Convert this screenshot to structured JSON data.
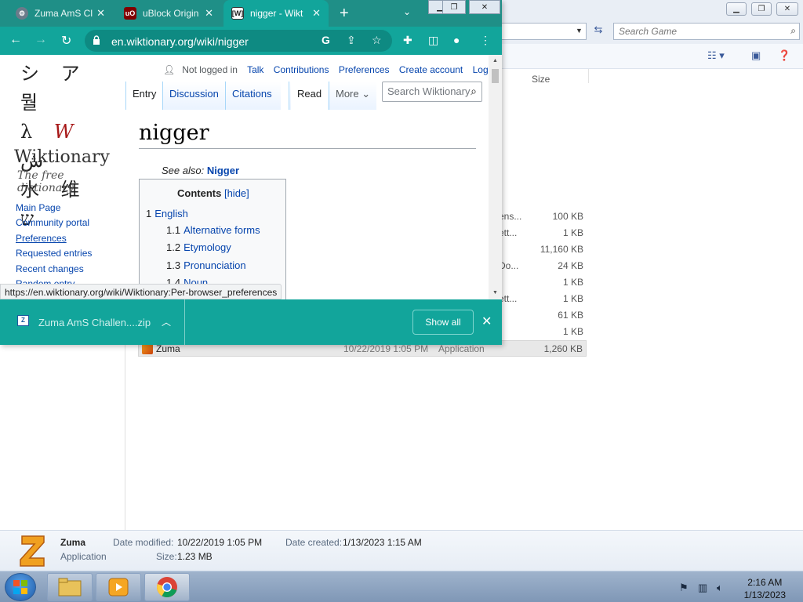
{
  "explorer": {
    "search_placeholder": "Search Game",
    "size_header": "Size",
    "rows": [
      {
        "name": "ens...",
        "size": "100 KB"
      },
      {
        "name": "ett...",
        "size": "1 KB"
      },
      {
        "name": "",
        "size": "11,160 KB"
      },
      {
        "name": "Do...",
        "size": "24 KB"
      },
      {
        "name": "",
        "size": "1 KB"
      },
      {
        "name": "ett...",
        "size": "1 KB"
      },
      {
        "name": "",
        "size": "61 KB"
      },
      {
        "name": "",
        "size": "1 KB"
      }
    ],
    "selected_row": {
      "name": "Zuma",
      "date": "10/22/2019 1:05 PM",
      "type": "Application",
      "size": "1,260 KB"
    },
    "details": {
      "name": "Zuma",
      "type": "Application",
      "date_modified_label": "Date modified:",
      "date_modified": "10/22/2019 1:05 PM",
      "date_created_label": "Date created:",
      "date_created": "1/13/2023 1:15 AM",
      "size_label": "Size:",
      "size": "1.23 MB"
    }
  },
  "taskbar": {
    "time": "2:16 AM",
    "date": "1/13/2023"
  },
  "chrome": {
    "tabs": [
      {
        "title": "Zuma AmS Cl",
        "icon": "zuma-tab-icon"
      },
      {
        "title": "uBlock Origin",
        "icon": "ublock-icon"
      },
      {
        "title": "nigger - Wikt",
        "icon": "wiktionary-icon",
        "active": true
      }
    ],
    "url": "en.wiktionary.org/wiki/nigger",
    "status_url": "https://en.wiktionary.org/wiki/Wiktionary:Per-browser_preferences",
    "download": {
      "filename": "Zuma AmS Challen....zip",
      "show_all": "Show all"
    }
  },
  "wiki": {
    "logo_name": "Wiktionary",
    "logo_tagline": "The free dictionary",
    "sidebar": [
      "Main Page",
      "Community portal",
      "Preferences",
      "Requested entries",
      "Recent changes",
      "Random entry"
    ],
    "personal": {
      "not_logged": "Not logged in",
      "talk": "Talk",
      "contributions": "Contributions",
      "preferences": "Preferences",
      "create": "Create account",
      "login": "Log in"
    },
    "tabs": {
      "entry": "Entry",
      "discussion": "Discussion",
      "citations": "Citations",
      "read": "Read",
      "more": "More"
    },
    "search_placeholder": "Search Wiktionary",
    "title": "nigger",
    "see_also_label": "See also:",
    "see_also_link": "Nigger",
    "toc": {
      "title": "Contents",
      "hide": "[hide]",
      "items": [
        {
          "num": "1",
          "label": "English"
        },
        {
          "num": "1.1",
          "label": "Alternative forms"
        },
        {
          "num": "1.2",
          "label": "Etymology"
        },
        {
          "num": "1.3",
          "label": "Pronunciation"
        },
        {
          "num": "1.4",
          "label": "Noun"
        }
      ]
    }
  }
}
